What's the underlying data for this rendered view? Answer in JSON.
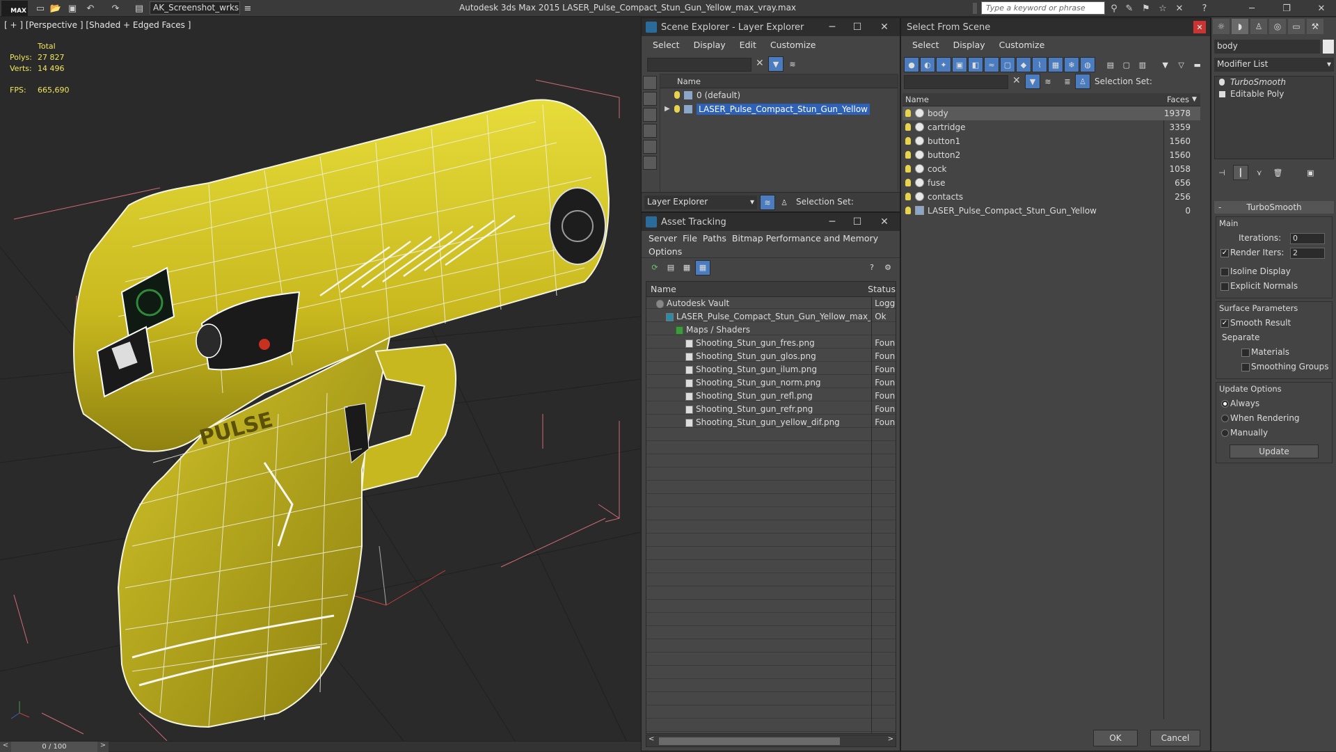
{
  "app": {
    "title": "Autodesk 3ds Max  2015     LASER_Pulse_Compact_Stun_Gun_Yellow_max_vray.max",
    "logo": "MAX",
    "workspace": "AK_Screenshot_wrksp",
    "search_placeholder": "Type a keyword or phrase"
  },
  "viewport": {
    "label": "[ + ] [Perspective ] [Shaded + Edged Faces ]",
    "stats": {
      "header": "Total",
      "polys_label": "Polys:",
      "polys": "27 827",
      "verts_label": "Verts:",
      "verts": "14 496",
      "fps_label": "FPS:",
      "fps": "665,690"
    },
    "brand_text": "PULSE",
    "timeslider": "0 / 100"
  },
  "scene_explorer": {
    "title": "Scene Explorer - Layer Explorer",
    "menu": [
      "Select",
      "Display",
      "Edit",
      "Customize"
    ],
    "column_name": "Name",
    "layers": [
      {
        "label": "0 (default)",
        "selected": false
      },
      {
        "label": "LASER_Pulse_Compact_Stun_Gun_Yellow",
        "selected": true
      }
    ],
    "explorer_dropdown": "Layer Explorer",
    "selection_set_label": "Selection Set:"
  },
  "asset_tracking": {
    "title": "Asset Tracking",
    "menu": [
      "Server",
      "File",
      "Paths",
      "Bitmap Performance and Memory"
    ],
    "menu2": [
      "Options"
    ],
    "col_name": "Name",
    "col_status": "Status",
    "rows": [
      {
        "name": "Autodesk Vault",
        "status": "Logged",
        "indent": 0,
        "icon": "vault"
      },
      {
        "name": "LASER_Pulse_Compact_Stun_Gun_Yellow_max_v...",
        "status": "Ok",
        "indent": 1,
        "icon": "max-file"
      },
      {
        "name": "Maps / Shaders",
        "status": "",
        "indent": 2,
        "icon": "folder"
      },
      {
        "name": "Shooting_Stun_gun_fres.png",
        "status": "Found",
        "indent": 3,
        "icon": "image"
      },
      {
        "name": "Shooting_Stun_gun_glos.png",
        "status": "Found",
        "indent": 3,
        "icon": "image"
      },
      {
        "name": "Shooting_Stun_gun_ilum.png",
        "status": "Found",
        "indent": 3,
        "icon": "image"
      },
      {
        "name": "Shooting_Stun_gun_norm.png",
        "status": "Found",
        "indent": 3,
        "icon": "image"
      },
      {
        "name": "Shooting_Stun_gun_refl.png",
        "status": "Found",
        "indent": 3,
        "icon": "image"
      },
      {
        "name": "Shooting_Stun_gun_refr.png",
        "status": "Found",
        "indent": 3,
        "icon": "image"
      },
      {
        "name": "Shooting_Stun_gun_yellow_dif.png",
        "status": "Found",
        "indent": 3,
        "icon": "image"
      }
    ]
  },
  "select_from_scene": {
    "title": "Select From Scene",
    "menu": [
      "Select",
      "Display",
      "Customize"
    ],
    "selection_set_label": "Selection Set:",
    "col_name": "Name",
    "col_faces": "Faces",
    "objects": [
      {
        "name": "body",
        "faces": "19378",
        "selected": true
      },
      {
        "name": "cartridge",
        "faces": "3359",
        "selected": false
      },
      {
        "name": "button1",
        "faces": "1560",
        "selected": false
      },
      {
        "name": "button2",
        "faces": "1560",
        "selected": false
      },
      {
        "name": "cock",
        "faces": "1058",
        "selected": false
      },
      {
        "name": "fuse",
        "faces": "656",
        "selected": false
      },
      {
        "name": "contacts",
        "faces": "256",
        "selected": false
      },
      {
        "name": "LASER_Pulse_Compact_Stun_Gun_Yellow",
        "faces": "0",
        "selected": false
      }
    ],
    "ok": "OK",
    "cancel": "Cancel"
  },
  "command_panel": {
    "object_name": "body",
    "modifier_list": "Modifier List",
    "stack": [
      "TurboSmooth",
      "Editable Poly"
    ],
    "rollout_title": "TurboSmooth",
    "main_group": "Main",
    "iterations_label": "Iterations:",
    "iterations": "0",
    "render_iters_label": "Render Iters:",
    "render_iters": "2",
    "isoline": "Isoline Display",
    "explicit_normals": "Explicit Normals",
    "surface_group": "Surface Parameters",
    "smooth_result": "Smooth Result",
    "separate": "Separate",
    "materials": "Materials",
    "smoothing_groups": "Smoothing Groups",
    "update_group": "Update Options",
    "always": "Always",
    "when_rendering": "When Rendering",
    "manually": "Manually",
    "update_btn": "Update"
  }
}
